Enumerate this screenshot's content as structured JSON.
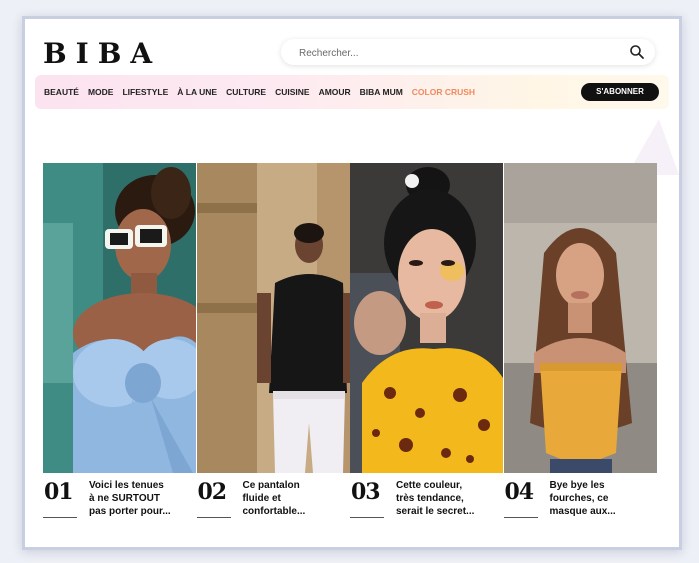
{
  "header": {
    "logo": "BIBA",
    "search": {
      "placeholder": "Rechercher..."
    }
  },
  "nav": {
    "items": [
      "BEAUTÉ",
      "MODE",
      "LIFESTYLE",
      "À LA UNE",
      "CULTURE",
      "CUISINE",
      "AMOUR",
      "BIBA MUM",
      "COLOR CRUSH"
    ],
    "accent_item": "COLOR CRUSH",
    "subscribe_label": "S'ABONNER"
  },
  "colors": {
    "accent": "#f08a5d",
    "button": "#111111",
    "nav_gradient_start": "#fbe3f0",
    "nav_gradient_end": "#fff9ec"
  },
  "icons": [
    "search-icon"
  ],
  "articles": [
    {
      "number": "01",
      "title_lines": [
        "Voici les tenues",
        "à ne SURTOUT",
        "pas porter pour..."
      ]
    },
    {
      "number": "02",
      "title_lines": [
        "Ce pantalon",
        "fluide et",
        "confortable..."
      ]
    },
    {
      "number": "03",
      "title_lines": [
        "Cette couleur,",
        "très tendance,",
        "serait le secret..."
      ]
    },
    {
      "number": "04",
      "title_lines": [
        "Bye bye les",
        "fourches, ce",
        "masque aux..."
      ]
    }
  ]
}
